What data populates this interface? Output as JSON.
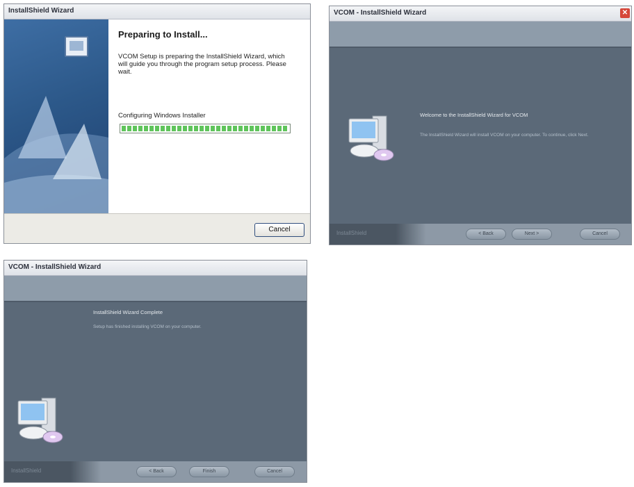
{
  "window1": {
    "title": "InstallShield Wizard",
    "heading": "Preparing to Install...",
    "description": "VCOM Setup is preparing the InstallShield Wizard, which will guide you through the program setup process.  Please wait.",
    "status": "Configuring Windows Installer",
    "progress_fraction": 1.0,
    "cancel_label": "Cancel"
  },
  "window2": {
    "title": "VCOM - InstallShield Wizard",
    "welcome_title": "Welcome to the InstallShield Wizard for VCOM",
    "welcome_text": "The InstallShield Wizard will install VCOM on your computer.  To continue, click Next.",
    "brand": "InstallShield",
    "buttons": {
      "back": "< Back",
      "next": "Next >",
      "cancel": "Cancel"
    }
  },
  "window3": {
    "title": "VCOM - InstallShield Wizard",
    "complete_title": "InstallShield Wizard Complete",
    "complete_text": "Setup has finished installing VCOM on your computer.",
    "brand": "InstallShield",
    "buttons": {
      "back": "< Back",
      "finish": "Finish",
      "cancel": "Cancel"
    }
  },
  "colors": {
    "banner_blue": "#2c5889",
    "skin_body": "#5b6978",
    "skin_band": "#8e9caa",
    "progress_green": "#5fc45b"
  }
}
